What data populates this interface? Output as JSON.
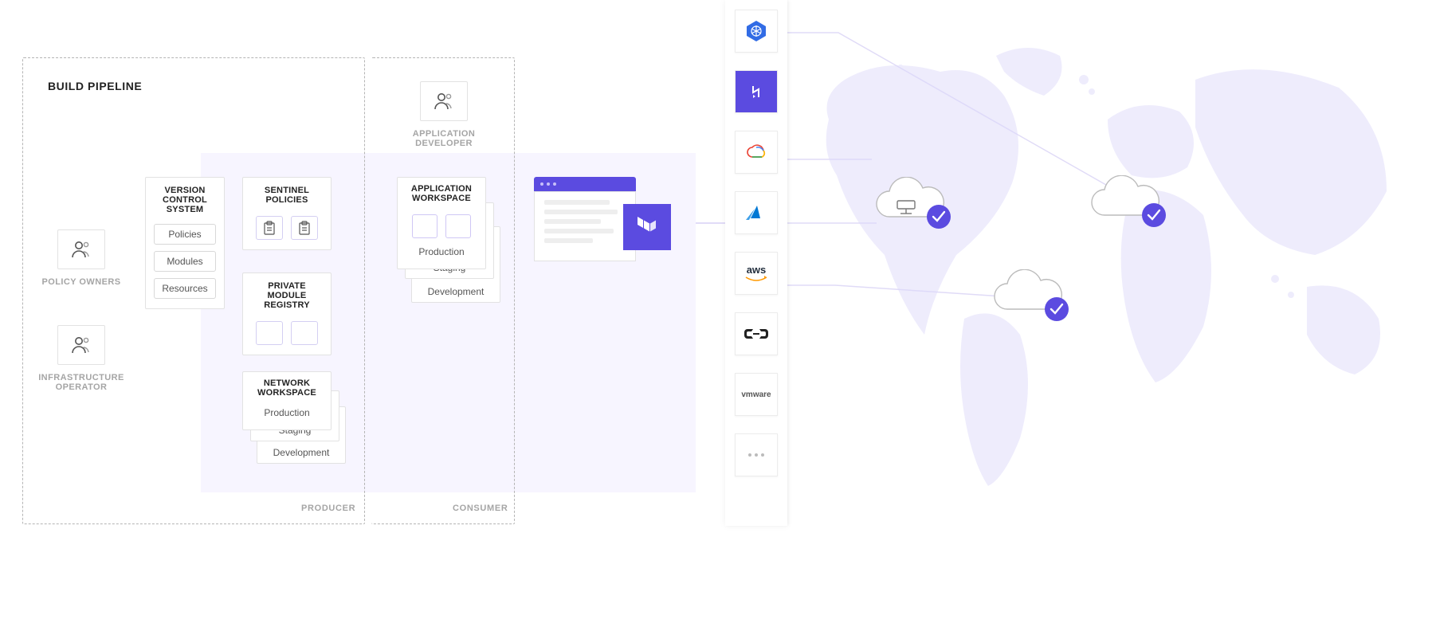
{
  "pipeline": {
    "title": "BUILD PIPELINE"
  },
  "roles": {
    "policy_owners": "POLICY OWNERS",
    "infra_operator": "INFRASTRUCTURE OPERATOR",
    "app_developer": "APPLICATION DEVELOPER"
  },
  "vcs": {
    "title": "VERSION CONTROL SYSTEM",
    "items": [
      "Policies",
      "Modules",
      "Resources"
    ]
  },
  "sentinel": {
    "title": "SENTINEL POLICIES"
  },
  "registry": {
    "title": "PRIVATE MODULE REGISTRY"
  },
  "network_ws": {
    "title": "NETWORK WORKSPACE",
    "envs": [
      "Production",
      "Staging",
      "Development"
    ]
  },
  "app_ws": {
    "title": "APPLICATION WORKSPACE",
    "envs": [
      "Production",
      "Staging",
      "Development"
    ]
  },
  "zones": {
    "producer": "PRODUCER",
    "consumer": "CONSUMER"
  },
  "providers": {
    "items": [
      {
        "id": "kubernetes",
        "label": "Kubernetes"
      },
      {
        "id": "heroku",
        "label": "Heroku"
      },
      {
        "id": "gcp",
        "label": "Google Cloud"
      },
      {
        "id": "azure",
        "label": "Azure"
      },
      {
        "id": "aws",
        "label": "aws"
      },
      {
        "id": "alibaba",
        "label": "Alibaba Cloud"
      },
      {
        "id": "vmware",
        "label": "vmware"
      },
      {
        "id": "more",
        "label": "..."
      }
    ]
  },
  "colors": {
    "accent": "#5b4be0",
    "accent_light": "#eceafd",
    "map_fill": "#dedafb",
    "muted": "#a5a5a5"
  }
}
